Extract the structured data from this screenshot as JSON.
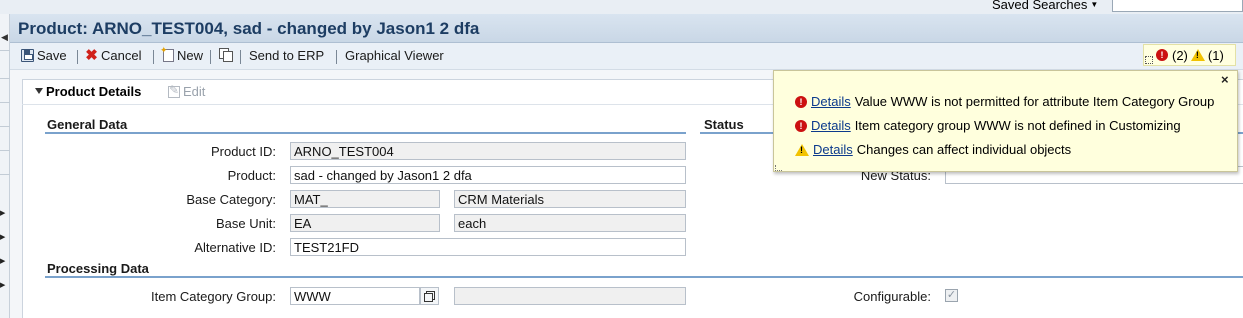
{
  "header": {
    "saved_searches_label": "Saved Searches",
    "title": "Product: ARNO_TEST004, sad - changed by Jason1 2 dfa"
  },
  "toolbar": {
    "save": "Save",
    "cancel": "Cancel",
    "new": "New",
    "send_to_erp": "Send to ERP",
    "graphical_viewer": "Graphical Viewer"
  },
  "messages_indicator": {
    "errors": "(2)",
    "warnings": "(1)"
  },
  "panel": {
    "title": "Product Details",
    "edit": "Edit"
  },
  "general_data": {
    "section_title": "General Data",
    "product_id_label": "Product ID:",
    "product_id": "ARNO_TEST004",
    "product_label": "Product:",
    "product": "sad - changed by Jason1 2 dfa",
    "base_category_label": "Base Category:",
    "base_category_code": "MAT_",
    "base_category_text": "CRM Materials",
    "base_unit_label": "Base Unit:",
    "base_unit_code": "EA",
    "base_unit_text": "each",
    "alternative_id_label": "Alternative ID:",
    "alternative_id": "TEST21FD"
  },
  "status": {
    "section_title": "Status",
    "new_status_label": "New Status:"
  },
  "processing_data": {
    "section_title": "Processing Data",
    "item_category_group_label": "Item Category Group:",
    "item_category_group": "WWW",
    "item_category_group_text": "",
    "configurable_label": "Configurable:",
    "configurable_checked": true
  },
  "message_popup": {
    "close": "×",
    "messages": [
      {
        "type": "error",
        "link": "Details",
        "text": "Value WWW is not permitted for attribute Item Category Group"
      },
      {
        "type": "error",
        "link": "Details",
        "text": "Item category group WWW is not defined in Customizing"
      },
      {
        "type": "warning",
        "link": "Details",
        "text": "Changes can affect individual objects"
      }
    ]
  }
}
